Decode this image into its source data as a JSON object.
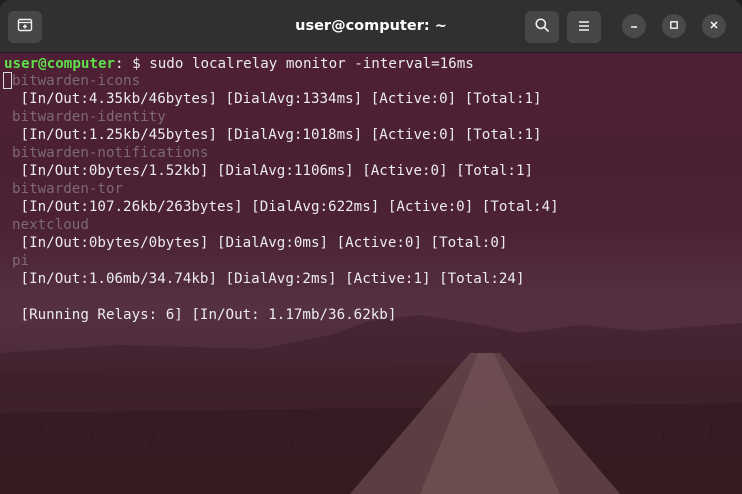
{
  "window": {
    "title": "user@computer: ~",
    "icons": {
      "new_tab": "new-tab-icon",
      "search": "search-icon",
      "menu": "hamburger-menu-icon",
      "minimize": "minimize-icon",
      "maximize": "maximize-icon",
      "close": "close-icon"
    }
  },
  "terminal": {
    "prompt": {
      "user_host": "user@computer",
      "colon": ":",
      "path": " ",
      "symbol": "$",
      "command": " sudo localrelay monitor -interval=16ms"
    },
    "relays": [
      {
        "name": "bitwarden-icons",
        "stats": " [In/Out:4.35kb/46bytes] [DialAvg:1334ms] [Active:0] [Total:1]"
      },
      {
        "name": "bitwarden-identity",
        "stats": " [In/Out:1.25kb/45bytes] [DialAvg:1018ms] [Active:0] [Total:1]"
      },
      {
        "name": "bitwarden-notifications",
        "stats": " [In/Out:0bytes/1.52kb] [DialAvg:1106ms] [Active:0] [Total:1]"
      },
      {
        "name": "bitwarden-tor",
        "stats": " [In/Out:107.26kb/263bytes] [DialAvg:622ms] [Active:0] [Total:4]"
      },
      {
        "name": "nextcloud",
        "stats": " [In/Out:0bytes/0bytes] [DialAvg:0ms] [Active:0] [Total:0]"
      },
      {
        "name": "pi",
        "stats": " [In/Out:1.06mb/34.74kb] [DialAvg:2ms] [Active:1] [Total:24]"
      }
    ],
    "summary": " [Running Relays: 6] [In/Out: 1.17mb/36.62kb]"
  },
  "colors": {
    "prompt_user": "#5fe04a",
    "prompt_path": "#4e86d8",
    "text": "#ececec",
    "relay_name": "#7d6a72",
    "titlebar": "#303030"
  }
}
